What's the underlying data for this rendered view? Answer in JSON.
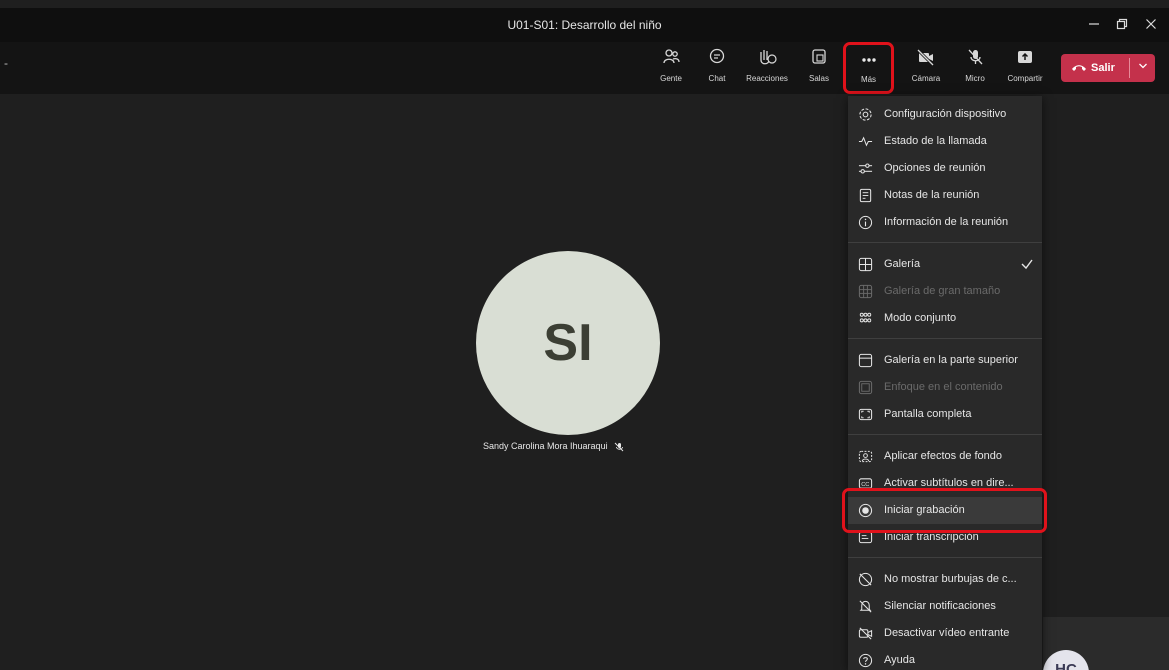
{
  "window": {
    "title": "U01-S01: Desarrollo del niño"
  },
  "toolbar": {
    "left_text": "-",
    "people": "Gente",
    "chat": "Chat",
    "reactions": "Reacciones",
    "rooms": "Salas",
    "more": "Más",
    "camera": "Cámara",
    "mic": "Micro",
    "share": "Compartir",
    "leave": "Salir"
  },
  "stage": {
    "avatar_initials": "SI",
    "participant_name": "Sandy Carolina Mora Ihuaraqui",
    "tile_initials": "HC"
  },
  "menu": {
    "items": [
      {
        "label": "Configuración dispositivo",
        "icon": "gear-icon"
      },
      {
        "label": "Estado de la llamada",
        "icon": "pulse-icon"
      },
      {
        "label": "Opciones de reunión",
        "icon": "sliders-icon"
      },
      {
        "label": "Notas de la reunión",
        "icon": "notes-icon"
      },
      {
        "label": "Información de la reunión",
        "icon": "info-icon"
      },
      {
        "label": "Galería",
        "icon": "grid-icon",
        "checked": true
      },
      {
        "label": "Galería de gran tamaño",
        "icon": "large-grid-icon",
        "disabled": true
      },
      {
        "label": "Modo conjunto",
        "icon": "together-icon"
      },
      {
        "label": "Galería en la parte superior",
        "icon": "top-gallery-icon"
      },
      {
        "label": "Enfoque en el contenido",
        "icon": "focus-icon",
        "disabled": true
      },
      {
        "label": "Pantalla completa",
        "icon": "fullscreen-icon"
      },
      {
        "label": "Aplicar efectos de fondo",
        "icon": "background-effects-icon"
      },
      {
        "label": "Activar subtítulos en dire...",
        "icon": "captions-icon"
      },
      {
        "label": "Iniciar grabación",
        "icon": "record-icon"
      },
      {
        "label": "Iniciar transcripción",
        "icon": "transcript-icon"
      },
      {
        "label": "No mostrar burbujas de c...",
        "icon": "no-bubbles-icon"
      },
      {
        "label": "Silenciar notificaciones",
        "icon": "mute-notifications-icon"
      },
      {
        "label": "Desactivar vídeo entrante",
        "icon": "video-off-icon"
      },
      {
        "label": "Ayuda",
        "icon": "help-icon"
      }
    ]
  },
  "colors": {
    "leave": "#c4314b",
    "highlight": "#e0121b",
    "avatar": "#d9ded4"
  }
}
